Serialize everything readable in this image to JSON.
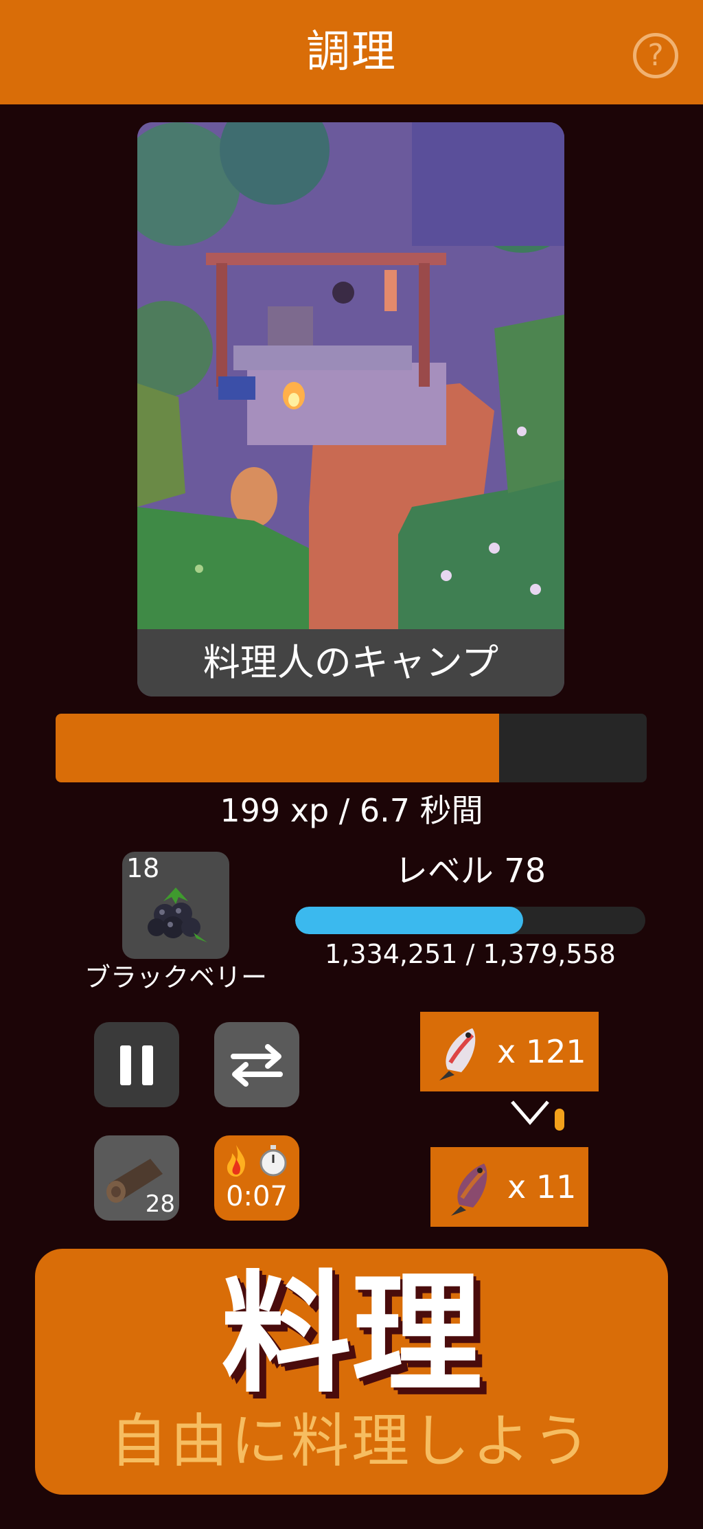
{
  "header": {
    "title": "調理",
    "help_symbol": "?"
  },
  "scene": {
    "caption": "料理人のキャンプ"
  },
  "progress": {
    "fraction": 0.75,
    "text": "199 xp / 6.7 秒間"
  },
  "ingredient": {
    "count": "18",
    "name": "ブラックベリー",
    "icon": "blackberry-icon"
  },
  "level": {
    "label": "レベル 78",
    "fraction": 0.65,
    "text": "1,334,251 / 1,379,558"
  },
  "controls": {
    "fuel_count": "28",
    "boost_time": "0:07"
  },
  "resources": {
    "input_qty": "x 121",
    "output_qty": "x 11"
  },
  "cook": {
    "title": "料理",
    "subtitle": "自由に料理しよう"
  },
  "colors": {
    "accent": "#d96d08",
    "background": "#1c0507",
    "level_bar": "#3bb9ee"
  }
}
